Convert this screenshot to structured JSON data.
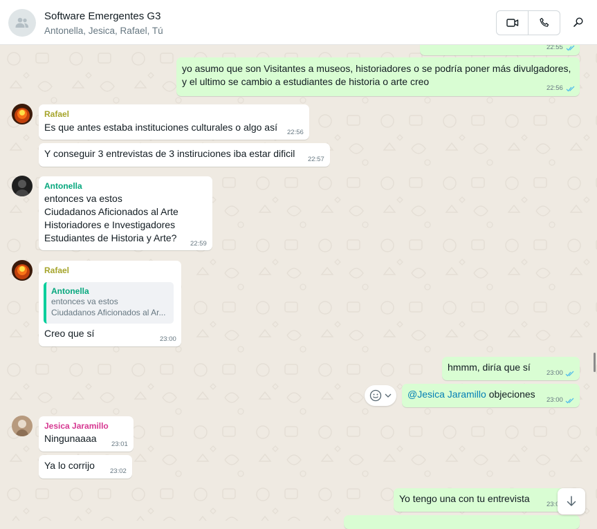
{
  "header": {
    "title": "Software Emergentes G3",
    "participants": "Antonella, Jesica, Rafael, Tú",
    "video_icon": "video-camera-icon",
    "call_icon": "phone-icon",
    "search_icon": "search-icon"
  },
  "messages": [
    {
      "id": "m1",
      "direction": "out",
      "text": "...",
      "time": "22:55",
      "read": true
    },
    {
      "id": "m2",
      "direction": "out",
      "lines": [
        "yo asumo que son Visitantes a museos, historiadores o se podría poner más divulgadores,",
        "y el ultimo se cambio a estudiantes de historia o arte creo"
      ],
      "time": "22:56",
      "read": true
    },
    {
      "id": "m3",
      "direction": "in",
      "sender": "Rafael",
      "sender_color": "#a5a42b",
      "text": "Es que antes estaba instituciones culturales o algo así",
      "time": "22:56"
    },
    {
      "id": "m4",
      "direction": "in",
      "text": "Y conseguir 3 entrevistas de 3 instiruciones iba estar dificil",
      "time": "22:57"
    },
    {
      "id": "m5",
      "direction": "in",
      "sender": "Antonella",
      "sender_color": "#06a77d",
      "lines": [
        "entonces va estos",
        "Ciudadanos Aficionados al Arte",
        "Historiadores e Investigadores",
        "Estudiantes de Historia y Arte?"
      ],
      "time": "22:59"
    },
    {
      "id": "m6",
      "direction": "in",
      "sender": "Rafael",
      "sender_color": "#a5a42b",
      "quote": {
        "name": "Antonella",
        "line1": "entonces va estos",
        "line2": "Ciudadanos Aficionados al Ar..."
      },
      "text": "Creo que sí",
      "time": "23:00"
    },
    {
      "id": "m7",
      "direction": "out",
      "text": "hmmm, diría que sí",
      "time": "23:00",
      "read": true
    },
    {
      "id": "m8",
      "direction": "out",
      "mention": "@Jesica Jaramillo",
      "text": " objeciones",
      "time": "23:00",
      "read": true
    },
    {
      "id": "m9",
      "direction": "in",
      "sender": "Jesica Jaramillo",
      "sender_color": "#d63891",
      "text": "Ningunaaaa",
      "time": "23:01"
    },
    {
      "id": "m10",
      "direction": "in",
      "text": "Ya lo corrijo",
      "time": "23:02"
    },
    {
      "id": "m11",
      "direction": "out",
      "text": "Yo tengo una con tu entrevista",
      "time": "23:0"
    }
  ],
  "colors": {
    "incoming": "#ffffff",
    "outgoing": "#d9fdd3",
    "read_ticks": "#53bdeb",
    "background": "#efeae2"
  },
  "icons": {
    "reaction": "smiley-icon",
    "reaction_menu": "chevron-down-icon",
    "scroll_down": "arrow-down-icon"
  }
}
